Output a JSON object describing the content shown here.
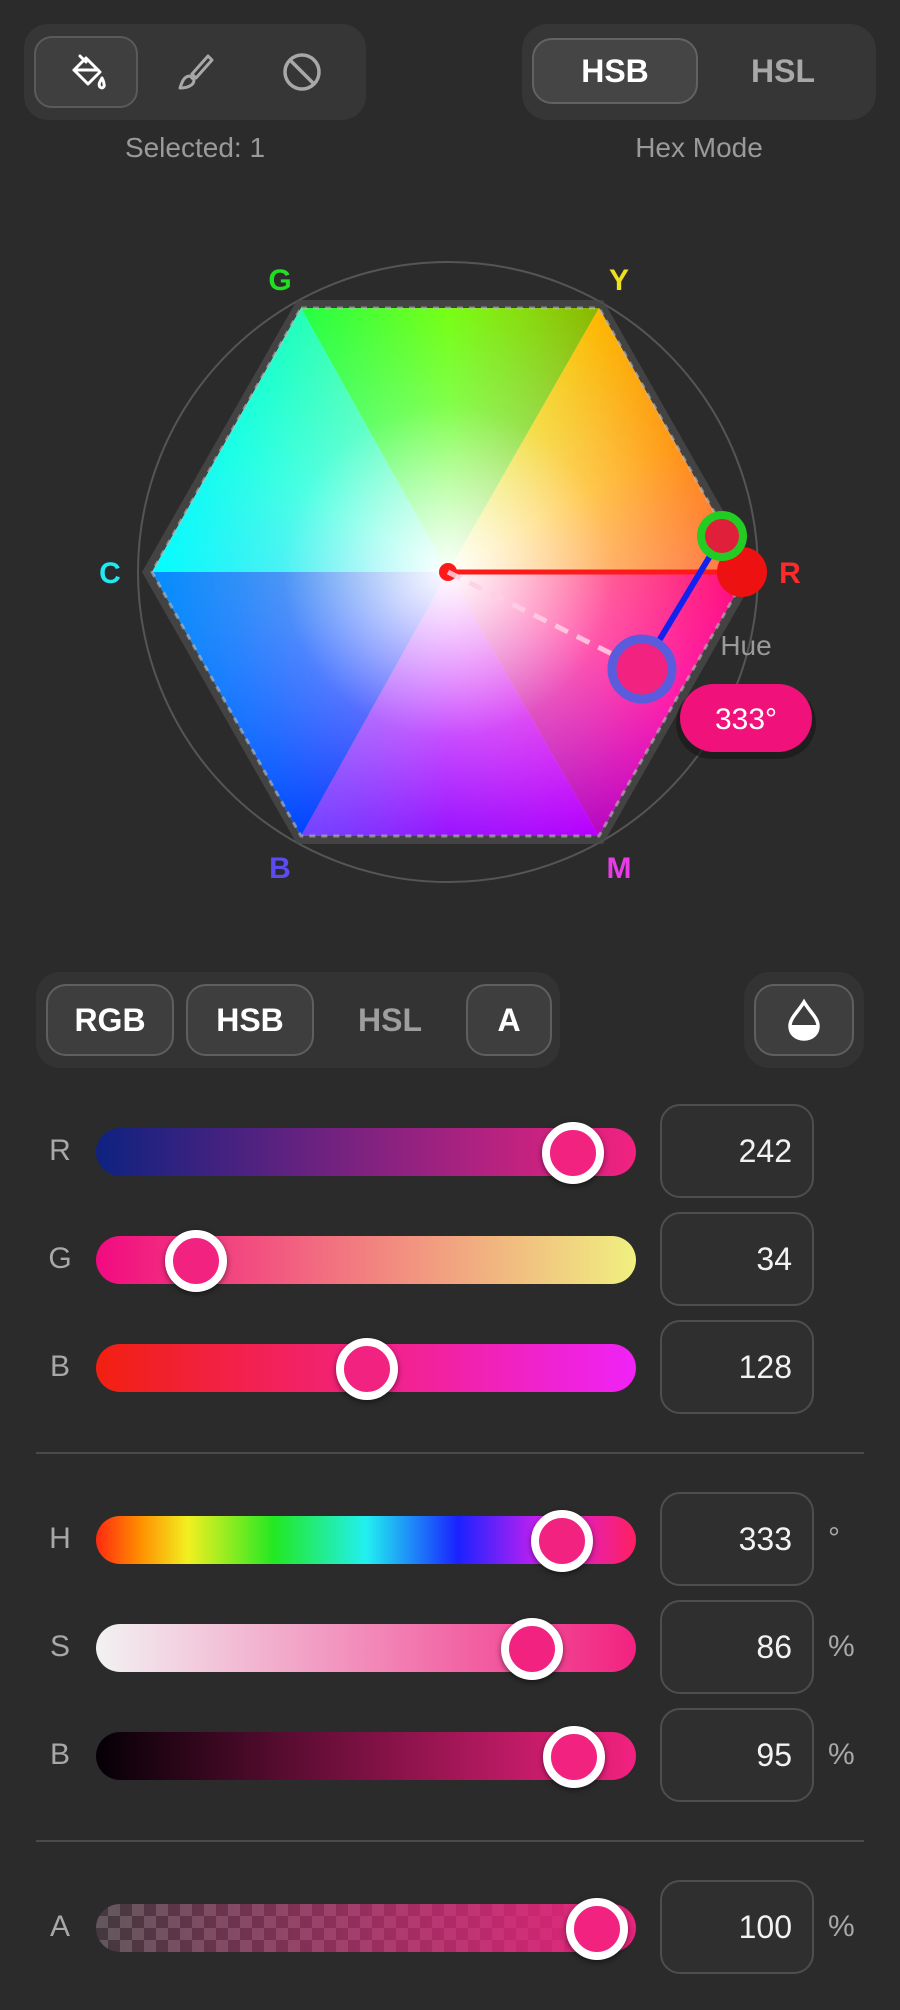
{
  "toolbar": {
    "tools": [
      {
        "name": "paint-bucket-icon",
        "active": true
      },
      {
        "name": "brush-icon",
        "active": false
      },
      {
        "name": "no-fill-icon",
        "active": false
      }
    ],
    "selected_label": "Selected: 1",
    "modes": [
      {
        "label": "HSB",
        "active": true
      },
      {
        "label": "HSL",
        "active": false
      }
    ],
    "hex_mode_label": "Hex Mode"
  },
  "wheel": {
    "vertex_labels": {
      "G": "G",
      "Y": "Y",
      "C": "C",
      "R": "R",
      "B": "B",
      "M": "M"
    },
    "colors": {
      "G": "#22dd22",
      "Y": "#f0e020",
      "C": "#22e8f0",
      "R": "#ff2a2a",
      "B": "#5544ff",
      "M": "#ee33ee"
    },
    "hue_label": "Hue",
    "hue_value": "333°",
    "selected_color": "#f22280"
  },
  "tabs": [
    {
      "label": "RGB",
      "active": true
    },
    {
      "label": "HSB",
      "active": true
    },
    {
      "label": "HSL",
      "active": false
    },
    {
      "label": "A",
      "active": true
    }
  ],
  "eyedropper_icon": "drop-icon",
  "rgb": [
    {
      "label": "R",
      "value": "242",
      "fraction": 0.949
    },
    {
      "label": "G",
      "value": "34",
      "fraction": 0.133
    },
    {
      "label": "B",
      "value": "128",
      "fraction": 0.502
    }
  ],
  "hsb": [
    {
      "label": "H",
      "value": "333",
      "unit": "°",
      "fraction": 0.925
    },
    {
      "label": "S",
      "value": "86",
      "unit": "%",
      "fraction": 0.86
    },
    {
      "label": "B",
      "value": "95",
      "unit": "%",
      "fraction": 0.95
    }
  ],
  "alpha": {
    "label": "A",
    "value": "100",
    "unit": "%",
    "fraction": 1.0
  }
}
